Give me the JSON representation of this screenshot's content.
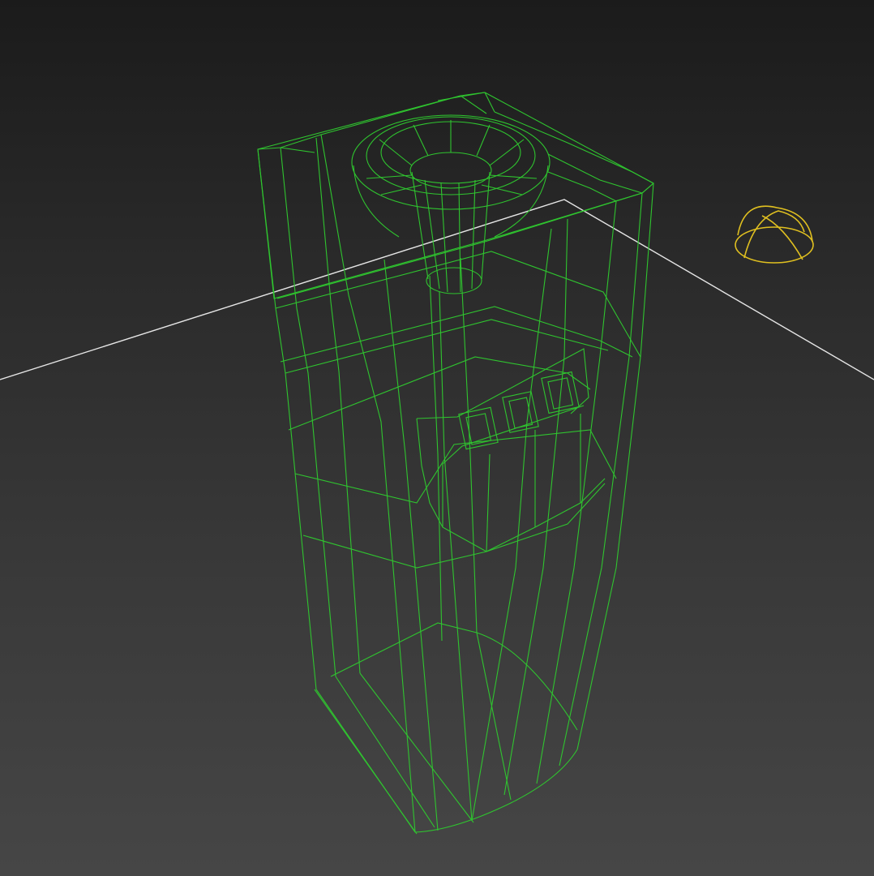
{
  "viewport": {
    "render_mode": "wireframe",
    "colors": {
      "background_top": "#1b1b1b",
      "background_bottom": "#464646",
      "object_wire": "#2fc42f",
      "grid_line": "#e6e6e6",
      "light_gizmo": "#e0c020"
    }
  },
  "scene": {
    "objects": [
      {
        "name": "water-cooler",
        "icon": "water-cooler-wireframe",
        "color": "#2fc42f"
      },
      {
        "name": "ground-plane",
        "icon": "ground-plane-edge",
        "color": "#e6e6e6"
      },
      {
        "name": "skylight",
        "icon": "dome-light-icon",
        "color": "#e0c020"
      }
    ]
  }
}
